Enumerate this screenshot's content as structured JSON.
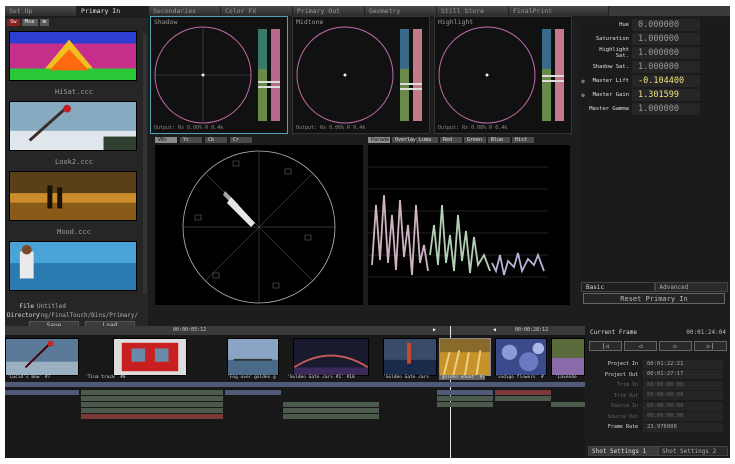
{
  "tabs": [
    "Set Up",
    "Primary In",
    "Secondaries",
    "Color FX",
    "Primary Out",
    "Geometry",
    "Still Store",
    "FinalPrint"
  ],
  "active_tab": 1,
  "browser": {
    "tabs": [
      "Sw",
      "Mse",
      "⊞"
    ],
    "thumbnails": [
      {
        "label": "HiSat.ccc"
      },
      {
        "label": "Look2.ccc"
      },
      {
        "label": "Mood.ccc"
      },
      {
        "label": ""
      }
    ],
    "file_label": "File",
    "file_value": "Untitled",
    "directory_label": "Directory",
    "directory_value": "/ng/FinalTouch/Bins/Primary/",
    "save_label": "Save",
    "load_label": "Load"
  },
  "wheels": [
    {
      "title": "Shadow",
      "output": "Output: Rx 0.00% R 0.4k"
    },
    {
      "title": "Midtone",
      "output": "Output: Rx 0.00% R 0.4k"
    },
    {
      "title": "Highlight",
      "output": "Output: Rx 0.00% R 0.4k"
    }
  ],
  "params": [
    {
      "label": "Hue",
      "value": "0.000000",
      "dot": false,
      "highlight": false
    },
    {
      "label": "Saturation",
      "value": "1.000000",
      "dot": false,
      "highlight": false
    },
    {
      "label": "Highlight Sat.",
      "value": "1.000000",
      "dot": false,
      "highlight": false
    },
    {
      "label": "Shadow Sat.",
      "value": "1.000000",
      "dot": false,
      "highlight": false
    },
    {
      "label": "Master Lift",
      "value": "-0.104400",
      "dot": true,
      "highlight": true
    },
    {
      "label": "Master Gain",
      "value": "1.301599",
      "dot": true,
      "highlight": true
    },
    {
      "label": "Master Gamma",
      "value": "1.000000",
      "dot": false,
      "highlight": false
    }
  ],
  "param_tabs": [
    "Basic",
    "Advanced"
  ],
  "reset_label": "Reset Primary In",
  "vectorscope_buttons": [
    "VBs",
    "Yc",
    "Cb",
    "Cr"
  ],
  "waveform_buttons": [
    "Parade",
    "Overlay",
    "Luma",
    "Red",
    "Green",
    "Blue",
    "Hist"
  ],
  "timeline": {
    "ruler_left": "00:00:05:12",
    "ruler_right": "00:00:28:12",
    "shots": [
      {
        "label": "'Lucid's Bow' #7"
      },
      {
        "label": "'Tina truck' #8"
      },
      {
        "label": "'Fog over golden g"
      },
      {
        "label": "'Golden Gate cars #1' #10"
      },
      {
        "label": "'Golden Gate cars"
      },
      {
        "label": "'golden wheat' #1"
      },
      {
        "label": "'indigo flowers' #"
      },
      {
        "label": "'Lavende"
      }
    ]
  },
  "playback": {
    "current_frame_label": "Current Frame",
    "current_frame": "00:01:24:04",
    "buttons": [
      "|◁",
      "◁",
      "▷",
      "▷|"
    ],
    "settings": [
      {
        "label": "Project In",
        "value": "00:01:22:21",
        "dim": false
      },
      {
        "label": "Project Out",
        "value": "00:01:27:17",
        "dim": false
      },
      {
        "label": "Trim In",
        "value": "00:00:00:00",
        "dim": true
      },
      {
        "label": "Trim Out",
        "value": "00:00:00:00",
        "dim": true
      },
      {
        "label": "Source In",
        "value": "00:00:00:00",
        "dim": true
      },
      {
        "label": "Source Out",
        "value": "00:00:00:00",
        "dim": true
      },
      {
        "label": "Frame Rate",
        "value": "23.976000",
        "dim": false
      }
    ],
    "tabs": [
      "Shot Settings 1",
      "Shot Settings 2"
    ]
  }
}
